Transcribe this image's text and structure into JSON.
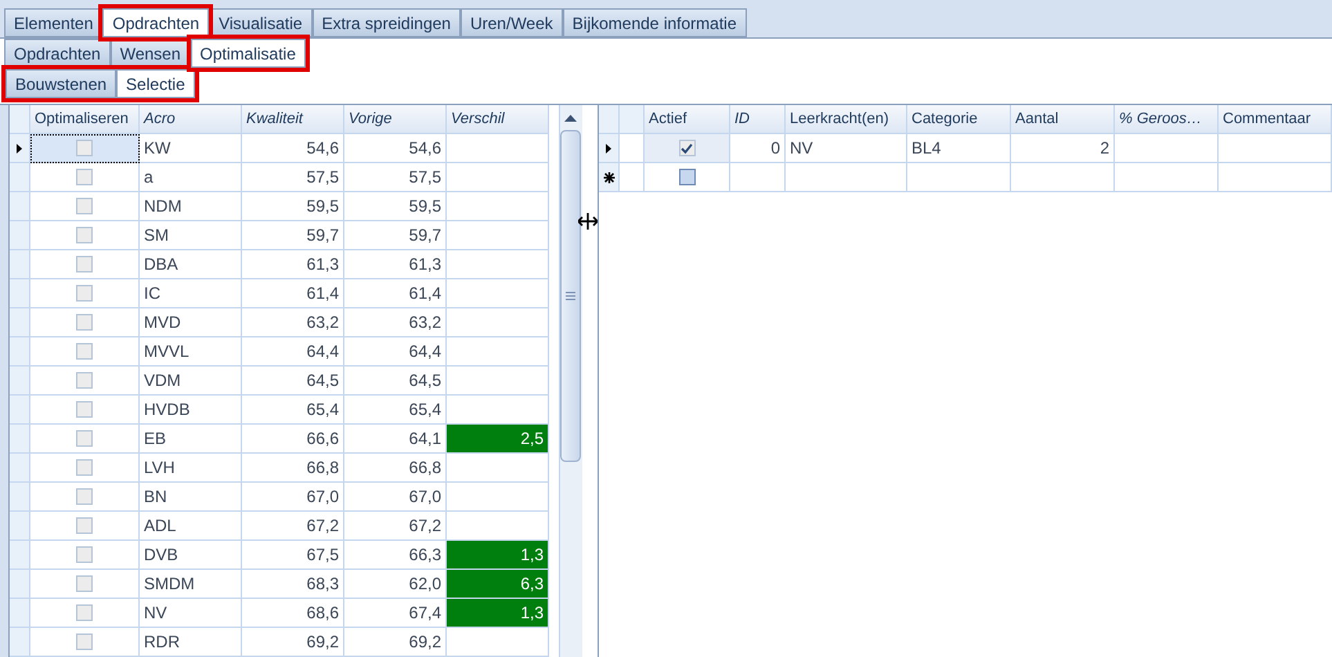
{
  "tab_rows": [
    {
      "tabs": [
        {
          "label": "Elementen",
          "selected": false,
          "highlighted": false
        },
        {
          "label": "Opdrachten",
          "selected": true,
          "highlighted": true
        },
        {
          "label": "Visualisatie",
          "selected": false,
          "highlighted": false
        },
        {
          "label": "Extra spreidingen",
          "selected": false,
          "highlighted": false
        },
        {
          "label": "Uren/Week",
          "selected": false,
          "highlighted": false
        },
        {
          "label": "Bijkomende informatie",
          "selected": false,
          "highlighted": false
        }
      ]
    },
    {
      "tabs": [
        {
          "label": "Opdrachten",
          "selected": false,
          "highlighted": false
        },
        {
          "label": "Wensen",
          "selected": false,
          "highlighted": false
        },
        {
          "label": "Optimalisatie",
          "selected": true,
          "highlighted": true
        }
      ]
    },
    {
      "highlighted": true,
      "tabs": [
        {
          "label": "Bouwstenen",
          "selected": false,
          "highlighted": false
        },
        {
          "label": "Selectie",
          "selected": true,
          "highlighted": false
        }
      ]
    }
  ],
  "left_grid": {
    "columns": [
      {
        "label": "Optimaliseren",
        "italic": false
      },
      {
        "label": "Acro",
        "italic": true
      },
      {
        "label": "Kwaliteit",
        "italic": true
      },
      {
        "label": "Vorige",
        "italic": true
      },
      {
        "label": "Verschil",
        "italic": true
      }
    ],
    "rows": [
      {
        "selected": true,
        "checked": false,
        "acro": "KW",
        "kwaliteit": "54,6",
        "vorige": "54,6",
        "highlighted": false
      },
      {
        "selected": false,
        "checked": false,
        "acro": "a",
        "kwaliteit": "57,5",
        "vorige": "57,5",
        "highlighted": false
      },
      {
        "selected": false,
        "checked": false,
        "acro": "NDM",
        "kwaliteit": "59,5",
        "vorige": "59,5",
        "highlighted": false
      },
      {
        "selected": false,
        "checked": false,
        "acro": "SM",
        "kwaliteit": "59,7",
        "vorige": "59,7",
        "highlighted": false
      },
      {
        "selected": false,
        "checked": false,
        "acro": "DBA",
        "kwaliteit": "61,3",
        "vorige": "61,3",
        "highlighted": false
      },
      {
        "selected": false,
        "checked": false,
        "acro": "IC",
        "kwaliteit": "61,4",
        "vorige": "61,4",
        "highlighted": false
      },
      {
        "selected": false,
        "checked": false,
        "acro": "MVD",
        "kwaliteit": "63,2",
        "vorige": "63,2",
        "highlighted": false
      },
      {
        "selected": false,
        "checked": false,
        "acro": "MVVL",
        "kwaliteit": "64,4",
        "vorige": "64,4",
        "highlighted": false
      },
      {
        "selected": false,
        "checked": false,
        "acro": "VDM",
        "kwaliteit": "64,5",
        "vorige": "64,5",
        "highlighted": false
      },
      {
        "selected": false,
        "checked": false,
        "acro": "HVDB",
        "kwaliteit": "65,4",
        "vorige": "65,4",
        "highlighted": false
      },
      {
        "selected": false,
        "checked": false,
        "acro": "EB",
        "kwaliteit": "66,6",
        "vorige": "64,1",
        "verschil": "2,5",
        "highlighted": true
      },
      {
        "selected": false,
        "checked": false,
        "acro": "LVH",
        "kwaliteit": "66,8",
        "vorige": "66,8",
        "highlighted": false
      },
      {
        "selected": false,
        "checked": false,
        "acro": "BN",
        "kwaliteit": "67,0",
        "vorige": "67,0",
        "highlighted": false
      },
      {
        "selected": false,
        "checked": false,
        "acro": "ADL",
        "kwaliteit": "67,2",
        "vorige": "67,2",
        "highlighted": false
      },
      {
        "selected": false,
        "checked": false,
        "acro": "DVB",
        "kwaliteit": "67,5",
        "vorige": "66,3",
        "verschil": "1,3",
        "highlighted": true
      },
      {
        "selected": false,
        "checked": false,
        "acro": "SMDM",
        "kwaliteit": "68,3",
        "vorige": "62,0",
        "verschil": "6,3",
        "highlighted": true
      },
      {
        "selected": false,
        "checked": false,
        "acro": "NV",
        "kwaliteit": "68,6",
        "vorige": "67,4",
        "verschil": "1,3",
        "highlighted": true
      },
      {
        "selected": false,
        "checked": false,
        "acro": "RDR",
        "kwaliteit": "69,2",
        "vorige": "69,2",
        "highlighted": false
      }
    ]
  },
  "right_grid": {
    "columns": [
      {
        "label": "Actief",
        "italic": false
      },
      {
        "label": "ID",
        "italic": true
      },
      {
        "label": "Leerkracht(en)",
        "italic": false
      },
      {
        "label": "Categorie",
        "italic": false
      },
      {
        "label": "Aantal",
        "italic": false
      },
      {
        "label": "% Geroos…",
        "italic": true
      },
      {
        "label": "Commentaar",
        "italic": false
      }
    ],
    "rows": [
      {
        "kind": "current",
        "checked": true,
        "id": "0",
        "leerkracht": "NV",
        "categorie": "BL4",
        "aantal": "2"
      },
      {
        "kind": "new",
        "checked": false
      }
    ]
  }
}
